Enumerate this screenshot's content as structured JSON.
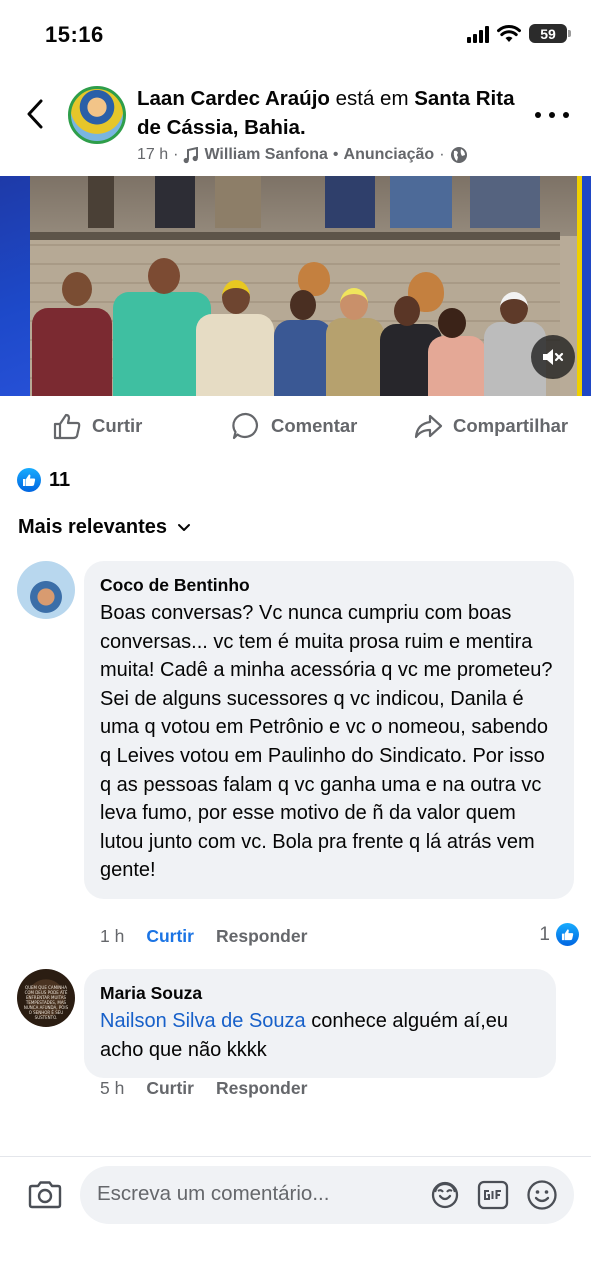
{
  "status_bar": {
    "time": "15:16",
    "battery": "59"
  },
  "post": {
    "author": "Laan Cardec Araújo",
    "connector": " está em ",
    "location": "Santa Rita de Cássia, Bahia.",
    "time": "17 h",
    "music_artist": "William Sanfona",
    "music_title": "Anunciação",
    "separator": "·",
    "separator_2": "•",
    "privacy_icon": "globe-icon"
  },
  "actions": {
    "like": "Curtir",
    "comment": "Comentar",
    "share": "Compartilhar"
  },
  "reactions": {
    "count": "11"
  },
  "sort": {
    "label": "Mais relevantes"
  },
  "comments": [
    {
      "author": "Coco de Bentinho",
      "text": "Boas conversas? Vc nunca cumpriu com boas conversas... vc tem é muita prosa ruim e mentira muita! Cadê a minha  acessória q vc me prometeu? Sei de alguns sucessores q vc indicou, Danila é uma q votou em Petrônio e vc o nomeou, sabendo q Leives votou em Paulinho do Sindicato. Por isso q as pessoas falam q vc ganha uma e na outra vc leva fumo, por esse motivo de ñ da valor quem lutou junto com vc. Bola pra frente q lá atrás vem gente!",
      "time": "1 h",
      "like_label": "Curtir",
      "reply_label": "Responder",
      "like_count": "1"
    },
    {
      "author": "Maria Souza",
      "mention": "Nailson Silva de Souza",
      "text": " conhece alguém aí,eu acho que não kkkk",
      "time": "5 h",
      "like_label": "Curtir",
      "reply_label": "Responder",
      "avatar_text": "QUEM QUE CAMINHA COM DEUS PODE ATÉ ENFRENTAR MUITAS TEMPESTADES, MAS NUNCA AFUNDA, POIS O SENHOR É SEU SUSTENTO."
    }
  ],
  "composer": {
    "placeholder": "Escreva um comentário..."
  },
  "colors": {
    "accent": "#1b74e4",
    "secondary_text": "#65676b",
    "bubble": "#f0f2f5"
  }
}
